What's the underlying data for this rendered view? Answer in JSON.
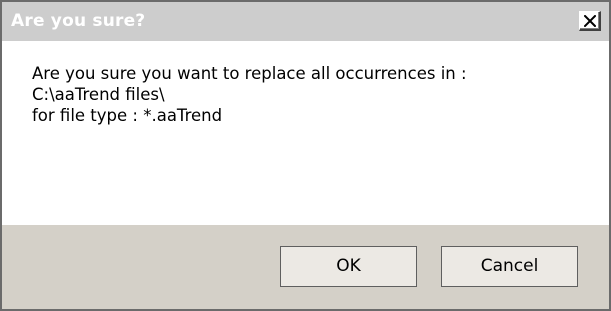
{
  "window": {
    "title": "Are you sure?",
    "close_icon": "close-icon"
  },
  "message": {
    "line1": "Are you sure you want to replace all occurrences in :",
    "line2": "C:\\aaTrend files\\",
    "line3": "for file type : *.aaTrend"
  },
  "buttons": {
    "ok_label": "OK",
    "cancel_label": "Cancel"
  },
  "colors": {
    "titlebar": "#cdcdcd",
    "title_text": "#ffffff",
    "content_bg": "#ffffff",
    "button_area_bg": "#d4d0c8",
    "button_bg": "#ece9e4"
  }
}
